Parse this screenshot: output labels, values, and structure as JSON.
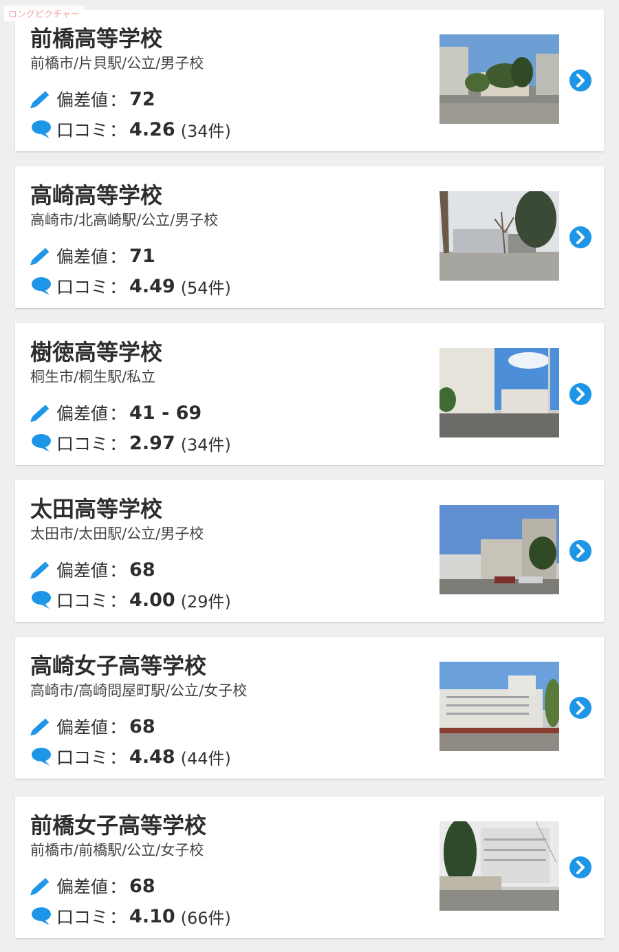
{
  "watermark": "ロングピクチャー",
  "labels": {
    "deviation": "偏差値",
    "reviews": "口コミ",
    "colon": "："
  },
  "colors": {
    "accent": "#1e96e8",
    "card_bg": "#ffffff",
    "page_bg": "#efefef"
  },
  "icons": {
    "deviation": "pencil-icon",
    "reviews": "speech-bubble-icon",
    "arrow": "chevron-right-circle-icon"
  },
  "schools": [
    {
      "name": "前橋高等学校",
      "meta": "前橋市/片貝駅/公立/男子校",
      "deviation": "72",
      "rating": "4.26",
      "review_count": "(34件)"
    },
    {
      "name": "高崎高等学校",
      "meta": "高崎市/北高崎駅/公立/男子校",
      "deviation": "71",
      "rating": "4.49",
      "review_count": "(54件)"
    },
    {
      "name": "樹徳高等学校",
      "meta": "桐生市/桐生駅/私立",
      "deviation": "41 - 69",
      "rating": "2.97",
      "review_count": "(34件)"
    },
    {
      "name": "太田高等学校",
      "meta": "太田市/太田駅/公立/男子校",
      "deviation": "68",
      "rating": "4.00",
      "review_count": "(29件)"
    },
    {
      "name": "高崎女子高等学校",
      "meta": "高崎市/高崎問屋町駅/公立/女子校",
      "deviation": "68",
      "rating": "4.48",
      "review_count": "(44件)"
    },
    {
      "name": "前橋女子高等学校",
      "meta": "前橋市/前橋駅/公立/女子校",
      "deviation": "68",
      "rating": "4.10",
      "review_count": "(66件)"
    }
  ]
}
